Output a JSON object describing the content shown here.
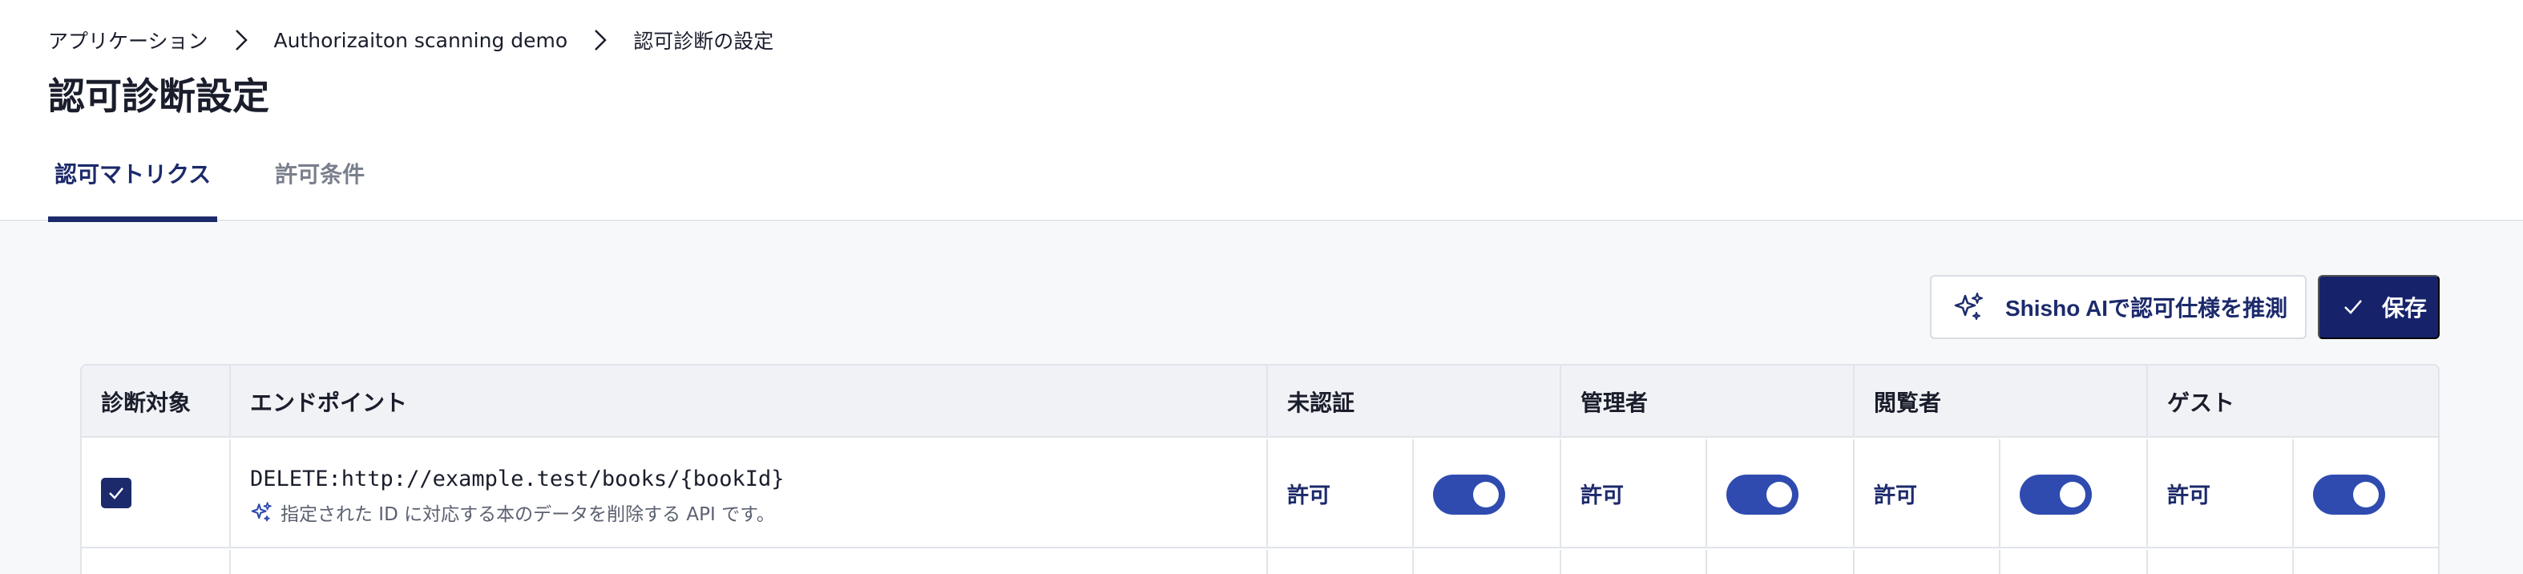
{
  "breadcrumb": {
    "items": [
      "アプリケーション",
      "Authorizaiton scanning demo",
      "認可診断の設定"
    ]
  },
  "page": {
    "title": "認可診断設定"
  },
  "tabs": [
    {
      "label": "認可マトリクス",
      "active": true
    },
    {
      "label": "許可条件",
      "active": false
    }
  ],
  "toolbar": {
    "ai_button_label": "Shisho AIで認可仕様を推測",
    "save_label": "保存"
  },
  "table": {
    "headers": [
      "診断対象",
      "エンドポイント",
      "未認証",
      "管理者",
      "閲覧者",
      "ゲスト"
    ],
    "rows": [
      {
        "checked": true,
        "endpoint": "DELETE:http://example.test/books/{bookId}",
        "description": "指定された ID に対応する本のデータを削除する API です。",
        "permissions": [
          {
            "label": "許可",
            "enabled": true
          },
          {
            "label": "許可",
            "enabled": true
          },
          {
            "label": "許可",
            "enabled": true
          },
          {
            "label": "許可",
            "enabled": true
          }
        ]
      }
    ]
  },
  "colors": {
    "primary": "#16236b",
    "toggle": "#2f4bb0",
    "tab_active": "#1c2a6b"
  }
}
